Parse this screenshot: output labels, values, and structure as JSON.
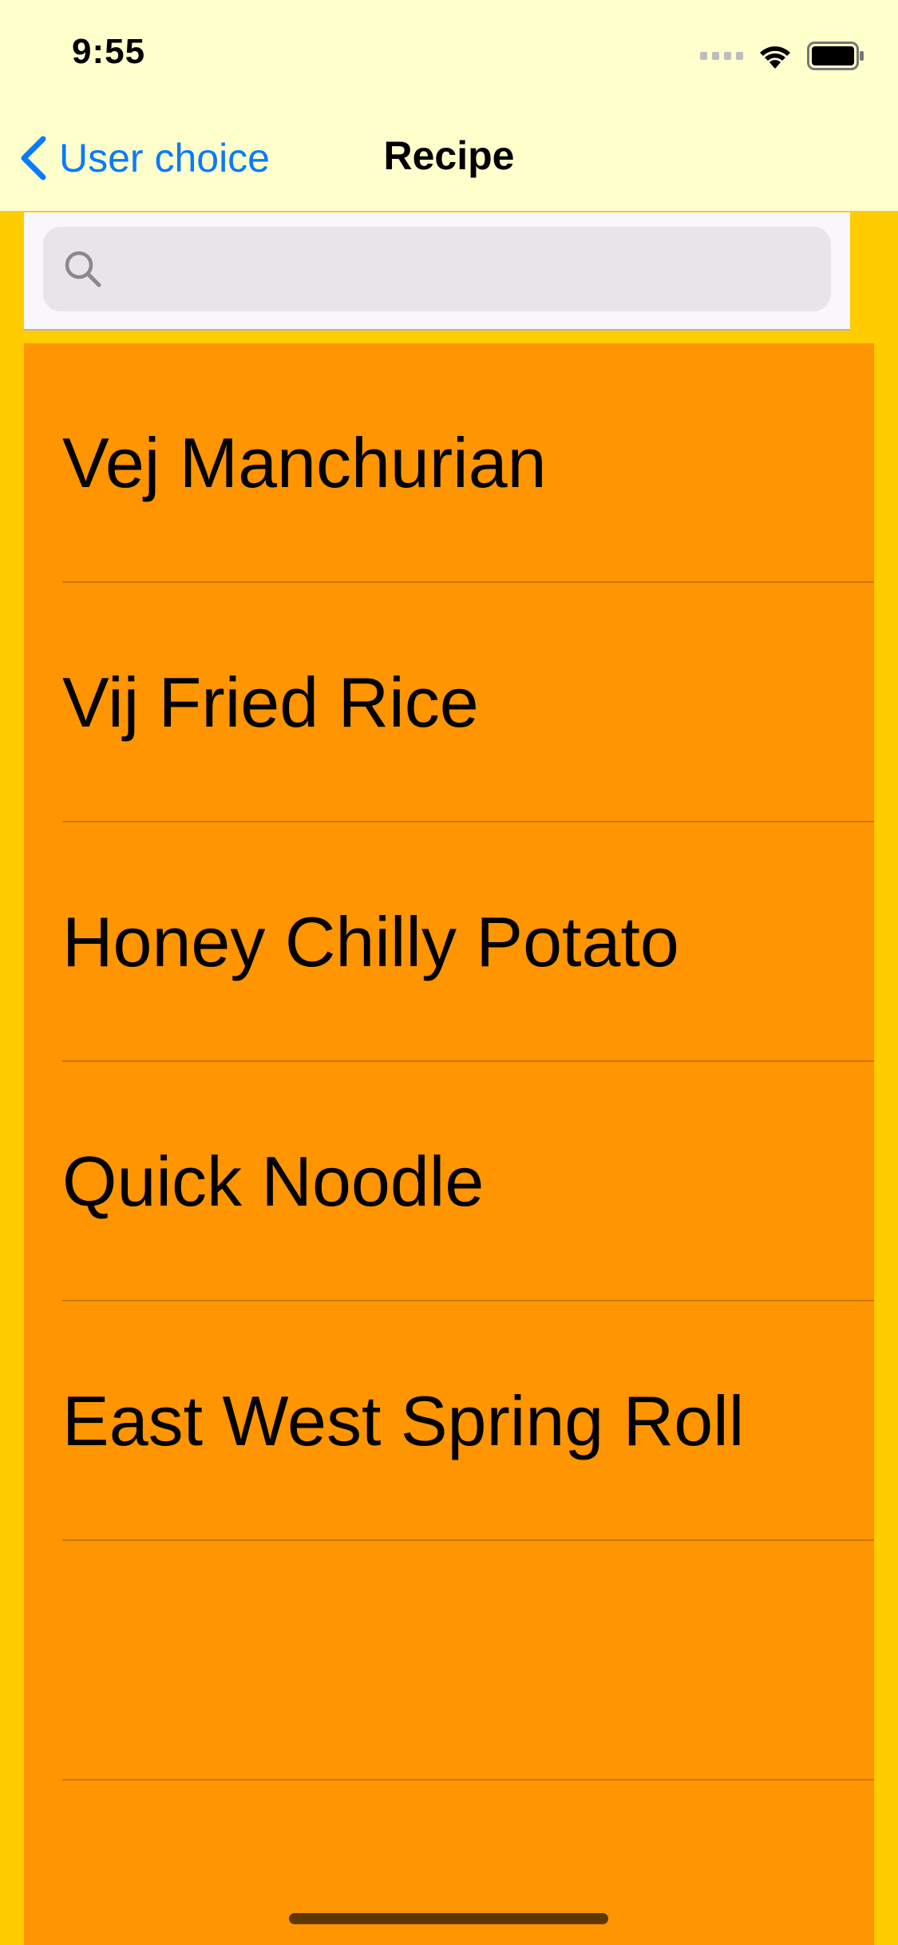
{
  "status_bar": {
    "time": "9:55"
  },
  "nav": {
    "back_label": "User choice",
    "title": "Recipe"
  },
  "search": {
    "placeholder": "",
    "value": ""
  },
  "recipes": [
    {
      "label": "Vej Manchurian"
    },
    {
      "label": "Vij Fried Rice"
    },
    {
      "label": "Honey Chilly Potato"
    },
    {
      "label": "Quick Noodle"
    },
    {
      "label": "East West Spring Roll"
    },
    {
      "label": ""
    }
  ],
  "colors": {
    "background": "#FFCC00",
    "nav_background": "#FFFFCC",
    "list_background": "#FF9500",
    "accent": "#0A7AFF"
  },
  "icons": {
    "back": "chevron-left-icon",
    "search": "magnifying-glass-icon",
    "signal": "cellular-signal-icon",
    "wifi": "wifi-icon",
    "battery": "battery-icon"
  }
}
